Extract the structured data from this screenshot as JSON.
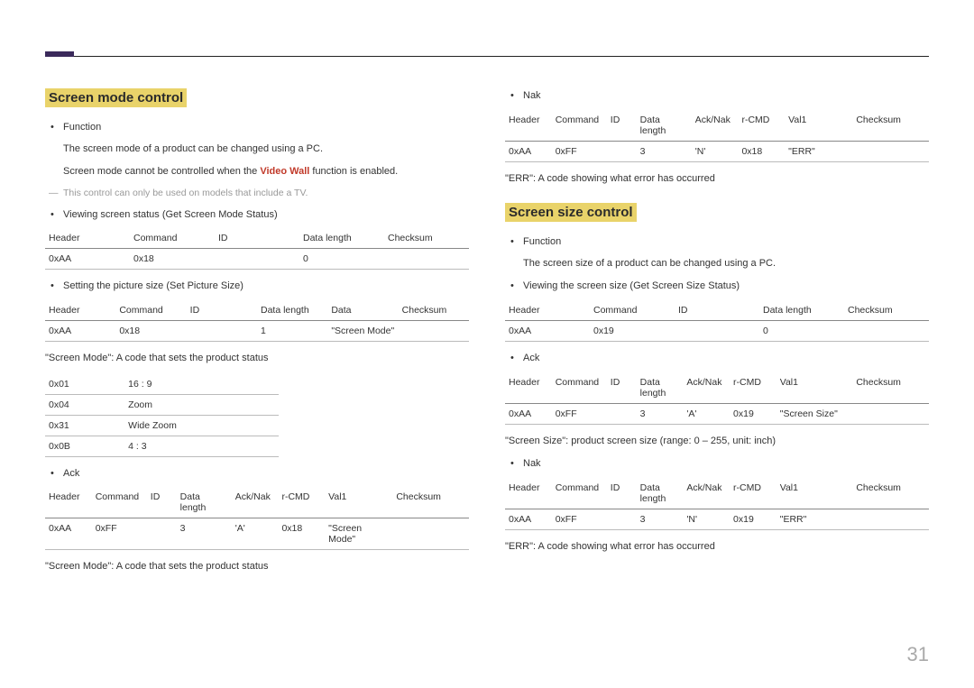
{
  "page_number": "31",
  "left": {
    "heading": "Screen mode control",
    "func_label": "Function",
    "func_p1": "The screen mode of a product can be changed using a PC.",
    "func_p2_pre": "Screen mode cannot be controlled when the ",
    "func_p2_bold": "Video Wall",
    "func_p2_post": " function is enabled.",
    "note": "This control can only be used on models that include a TV.",
    "view_label": "Viewing screen status (Get Screen Mode Status)",
    "t1h": {
      "c1": "Header",
      "c2": "Command",
      "c3": "ID",
      "c4": "Data length",
      "c5": "Checksum"
    },
    "t1r": {
      "c1": "0xAA",
      "c2": "0x18",
      "c3": "",
      "c4": "0",
      "c5": ""
    },
    "set_label": "Setting the picture size (Set Picture Size)",
    "t2h": {
      "c1": "Header",
      "c2": "Command",
      "c3": "ID",
      "c4": "Data length",
      "c5": "Data",
      "c6": "Checksum"
    },
    "t2r": {
      "c1": "0xAA",
      "c2": "0x18",
      "c3": "",
      "c4": "1",
      "c5": "\"Screen Mode\"",
      "c6": ""
    },
    "sm_desc": "\"Screen Mode\": A code that sets the product status",
    "codes": [
      {
        "k": "0x01",
        "v": "16 : 9"
      },
      {
        "k": "0x04",
        "v": "Zoom"
      },
      {
        "k": "0x31",
        "v": "Wide Zoom"
      },
      {
        "k": "0x0B",
        "v": "4 : 3"
      }
    ],
    "ack_label": "Ack",
    "t3h": {
      "c1": "Header",
      "c2": "Command",
      "c3": "ID",
      "c4": "Data length",
      "c5": "Ack/Nak",
      "c6": "r-CMD",
      "c7": "Val1",
      "c8": "Checksum"
    },
    "t3r": {
      "c1": "0xAA",
      "c2": "0xFF",
      "c3": "",
      "c4": "3",
      "c5": "'A'",
      "c6": "0x18",
      "c7": "\"Screen Mode\"",
      "c8": ""
    },
    "sm_desc2": "\"Screen Mode\": A code that sets the product status"
  },
  "right": {
    "nak_label": "Nak",
    "t4h": {
      "c1": "Header",
      "c2": "Command",
      "c3": "ID",
      "c4": "Data length",
      "c5": "Ack/Nak",
      "c6": "r-CMD",
      "c7": "Val1",
      "c8": "Checksum"
    },
    "t4r": {
      "c1": "0xAA",
      "c2": "0xFF",
      "c3": "",
      "c4": "3",
      "c5": "'N'",
      "c6": "0x18",
      "c7": "\"ERR\"",
      "c8": ""
    },
    "err_desc": "\"ERR\": A code showing what error has occurred",
    "heading2": "Screen size control",
    "func2_label": "Function",
    "func2_p1": "The screen size of a product can be changed using a PC.",
    "view2_label": "Viewing the screen size (Get Screen Size Status)",
    "t5h": {
      "c1": "Header",
      "c2": "Command",
      "c3": "ID",
      "c4": "Data length",
      "c5": "Checksum"
    },
    "t5r": {
      "c1": "0xAA",
      "c2": "0x19",
      "c3": "",
      "c4": "0",
      "c5": ""
    },
    "ack2_label": "Ack",
    "t6h": {
      "c1": "Header",
      "c2": "Command",
      "c3": "ID",
      "c4": "Data length",
      "c5": "Ack/Nak",
      "c6": "r-CMD",
      "c7": "Val1",
      "c8": "Checksum"
    },
    "t6r": {
      "c1": "0xAA",
      "c2": "0xFF",
      "c3": "",
      "c4": "3",
      "c5": "'A'",
      "c6": "0x19",
      "c7": "\"Screen Size\"",
      "c8": ""
    },
    "ss_desc": "\"Screen Size\": product screen size (range: 0 – 255, unit: inch)",
    "nak2_label": "Nak",
    "t7h": {
      "c1": "Header",
      "c2": "Command",
      "c3": "ID",
      "c4": "Data length",
      "c5": "Ack/Nak",
      "c6": "r-CMD",
      "c7": "Val1",
      "c8": "Checksum"
    },
    "t7r": {
      "c1": "0xAA",
      "c2": "0xFF",
      "c3": "",
      "c4": "3",
      "c5": "'N'",
      "c6": "0x19",
      "c7": "\"ERR\"",
      "c8": ""
    },
    "err2_desc": "\"ERR\": A code showing what error has occurred"
  }
}
